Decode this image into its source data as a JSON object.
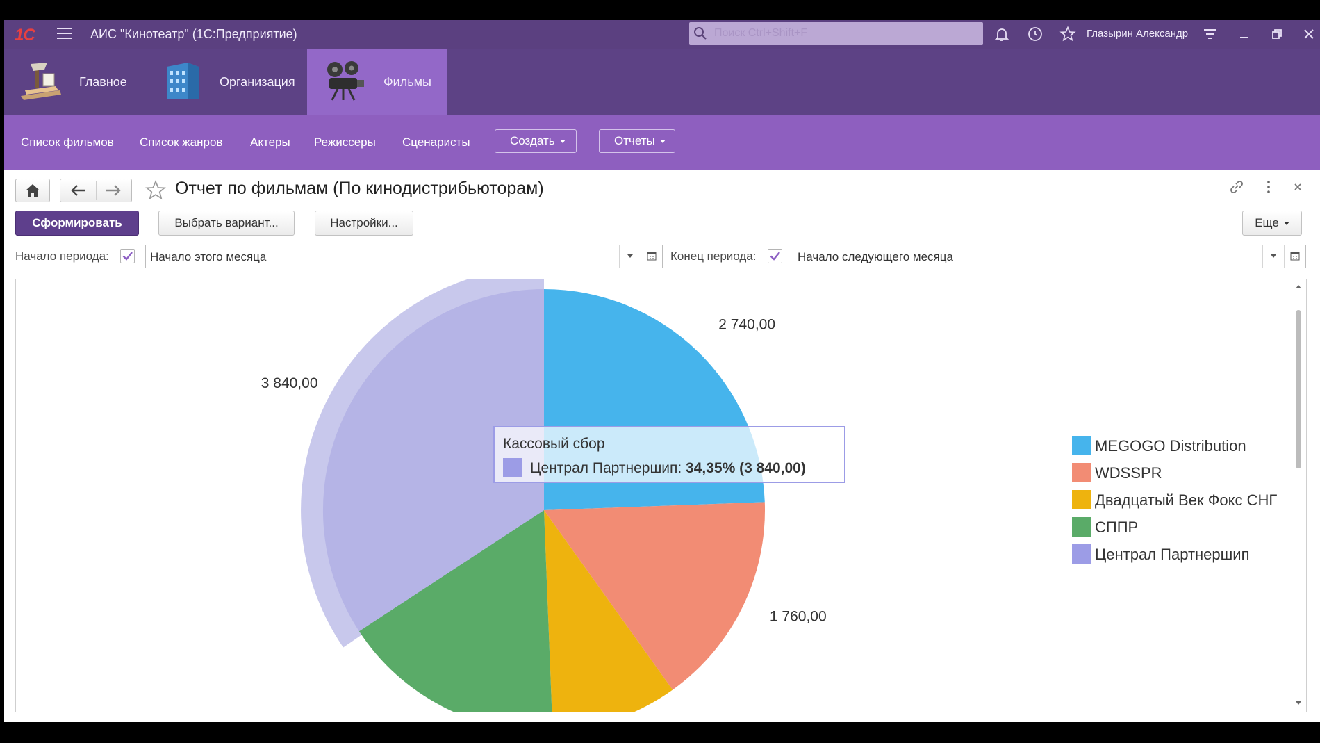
{
  "window": {
    "app_title": "АИС \"Кинотеатр\"  (1С:Предприятие)",
    "logo_text": "1С",
    "search_placeholder": "Поиск Ctrl+Shift+F",
    "user_name": "Глазырин Александр"
  },
  "sections": [
    {
      "label": "Главное",
      "icon": "desk-lamp-icon",
      "active": false
    },
    {
      "label": "Организация",
      "icon": "office-building-icon",
      "active": false
    },
    {
      "label": "Фильмы",
      "icon": "film-projector-icon",
      "active": true
    }
  ],
  "nav": {
    "links": [
      "Список фильмов",
      "Список жанров",
      "Актеры",
      "Режиссеры",
      "Сценаристы"
    ],
    "create_label": "Создать",
    "reports_label": "Отчеты"
  },
  "form": {
    "title": "Отчет по фильмам (По кинодистрибьюторам)",
    "generate_label": "Сформировать",
    "choose_variant_label": "Выбрать вариант...",
    "settings_label": "Настройки...",
    "more_label": "Еще"
  },
  "period": {
    "start_label": "Начало периода:",
    "start_checked": true,
    "start_value": "Начало этого месяца",
    "end_label": "Конец периода:",
    "end_checked": true,
    "end_value": "Начало следующего месяца"
  },
  "colors": {
    "accent_dark": "#5b4080",
    "accent": "#8e5fbf",
    "check": "#8d5fc4"
  },
  "chart_data": {
    "type": "pie",
    "series_name": "Кассовый сбор",
    "slices": [
      {
        "name": "MEGOGO Distribution",
        "value": 2740,
        "label": "2 740,00",
        "color": "#46b4ec"
      },
      {
        "name": "WDSSPR",
        "value": 1760,
        "label": "1 760,00",
        "color": "#f28c74"
      },
      {
        "name": "Двадцатый Век Фокс СНГ",
        "value": 1040,
        "label": "",
        "color": "#eeb30e"
      },
      {
        "name": "СППР",
        "value": 1840,
        "label": "",
        "color": "#5aab68"
      },
      {
        "name": "Централ Партнершип",
        "value": 3840,
        "label": "3 840,00",
        "color": "#b5b4e6",
        "legend_color": "#9c9ce6",
        "highlighted": true
      }
    ],
    "tooltip": {
      "title": "Кассовый сбор",
      "series": "Централ Партнершип:",
      "value": "34,35% (3 840,00)"
    },
    "legend_position": "right"
  }
}
